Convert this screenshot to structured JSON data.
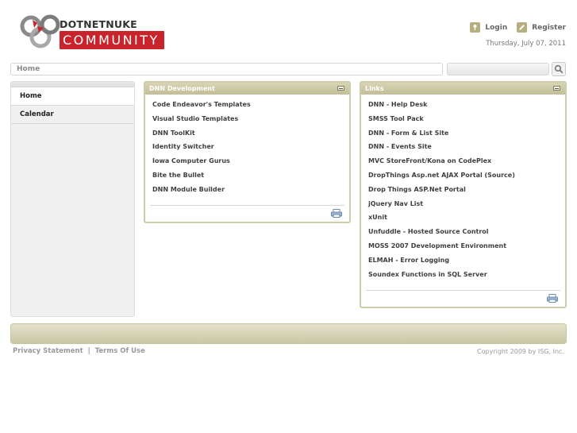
{
  "header": {
    "logo_top": "DOTNETNUKE",
    "logo_bottom": "COMMUNITY",
    "login_label": "Login",
    "register_label": "Register",
    "date": "Thursday, July 07, 2011",
    "brand_color": "#c9232b"
  },
  "breadcrumb": {
    "current": "Home"
  },
  "search": {
    "value": "",
    "icon": "search-icon"
  },
  "leftnav": {
    "items": [
      {
        "label": "Home",
        "active": true
      },
      {
        "label": "Calendar",
        "active": false
      }
    ]
  },
  "panels": {
    "dnn_dev": {
      "title": "DNN Development",
      "links": [
        "Code Endeavor's Templates",
        "Visual Studio Templates",
        "DNN ToolKit",
        "Identity Switcher",
        "Iowa Computer Gurus",
        "Bite the Bullet",
        "DNN Module Builder"
      ]
    },
    "links": {
      "title": "Links",
      "links": [
        "DNN - Help Desk",
        "SMSS Tool Pack",
        "DNN - Form & List Site",
        "DNN - Events Site",
        "MVC StoreFront/Kona on CodePlex",
        "DropThings Asp.net AJAX Portal (Source)",
        "Drop Things ASP.Net Portal",
        "jQuery Nav List",
        "xUnit",
        "Unfuddle - Hosted Source Control",
        "MOSS 2007 Development Environment",
        "ELMAH - Error Logging",
        "Soundex Functions in SQL Server"
      ]
    }
  },
  "footer": {
    "privacy": "Privacy Statement",
    "separator": "|",
    "terms": "Terms Of Use",
    "copyright": "Copyright 2009 by ISG, Inc."
  }
}
